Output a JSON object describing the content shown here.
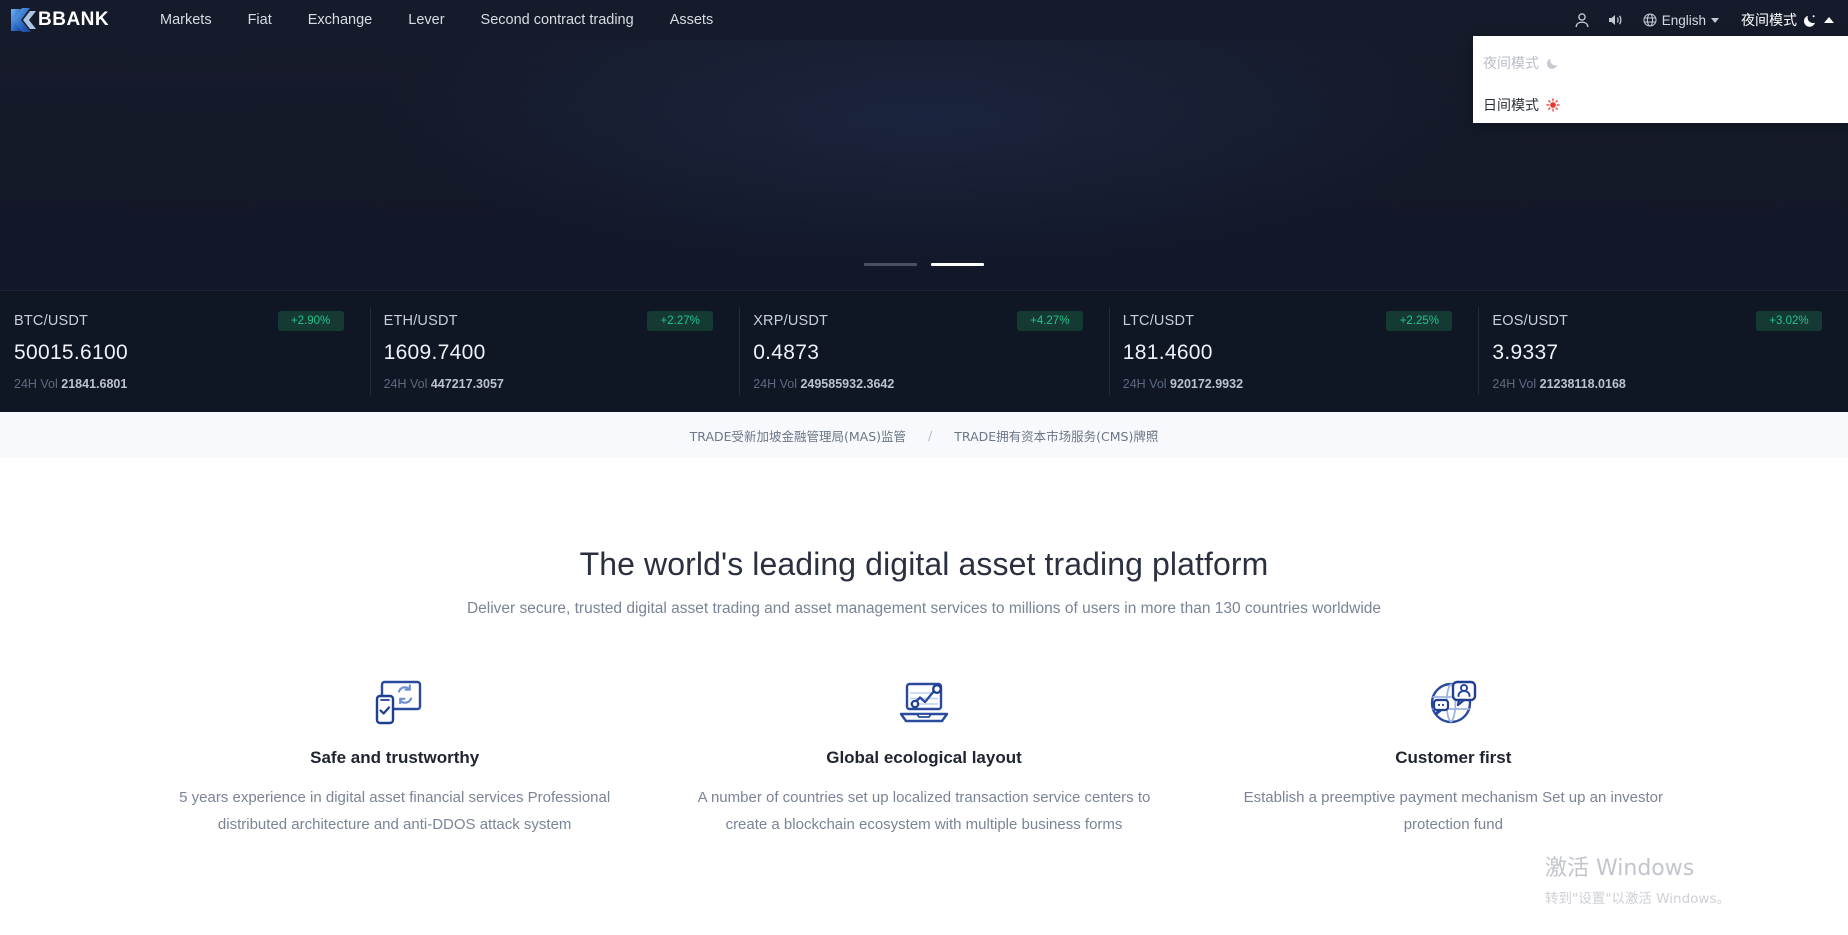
{
  "header": {
    "logo_text": "BBANK",
    "logo_icon": "k-logo-icon",
    "nav": [
      {
        "label": "Markets"
      },
      {
        "label": "Fiat"
      },
      {
        "label": "Exchange"
      },
      {
        "label": "Lever"
      },
      {
        "label": "Second contract trading"
      },
      {
        "label": "Assets"
      }
    ],
    "account_icon": "user-icon",
    "sound_icon": "speaker-icon",
    "globe_icon": "globe-icon",
    "language": "English",
    "theme_label": "夜间模式",
    "moon_icon": "moon-icon"
  },
  "theme_menu": {
    "items": [
      {
        "label": "夜间模式",
        "icon": "moon-icon"
      },
      {
        "label": "日间模式",
        "icon": "sun-icon"
      }
    ]
  },
  "hero": {
    "carousel": {
      "slides": 2,
      "active_index": 1
    }
  },
  "tickers": [
    {
      "pair": "BTC/USDT",
      "change": "+2.90%",
      "price": "50015.6100",
      "vol_label": "24H Vol",
      "vol": "21841.6801"
    },
    {
      "pair": "ETH/USDT",
      "change": "+2.27%",
      "price": "1609.7400",
      "vol_label": "24H Vol",
      "vol": "447217.3057"
    },
    {
      "pair": "XRP/USDT",
      "change": "+4.27%",
      "price": "0.4873",
      "vol_label": "24H Vol",
      "vol": "249585932.3642"
    },
    {
      "pair": "LTC/USDT",
      "change": "+2.25%",
      "price": "181.4600",
      "vol_label": "24H Vol",
      "vol": "920172.9932"
    },
    {
      "pair": "EOS/USDT",
      "change": "+3.02%",
      "price": "3.9337",
      "vol_label": "24H Vol",
      "vol": "21238118.0168"
    }
  ],
  "license_bar": {
    "left": "TRADE受新加坡金融管理局(MAS)监管",
    "separator": "/",
    "right": "TRADE拥有资本市场服务(CMS)牌照"
  },
  "main": {
    "title": "The world's leading digital asset trading platform",
    "subtitle": "Deliver secure, trusted digital asset trading and asset management services to millions of users in more than 130 countries worldwide",
    "features": [
      {
        "icon": "monitor-sync-icon",
        "title": "Safe and trustworthy",
        "desc": "5 years experience in digital asset financial services\nProfessional distributed architecture and anti-DDOS attack system"
      },
      {
        "icon": "laptop-chart-icon",
        "title": "Global ecological layout",
        "desc": "A number of countries set up localized transaction service centers\nto create a blockchain ecosystem with multiple business forms"
      },
      {
        "icon": "globe-support-icon",
        "title": "Customer first",
        "desc": "Establish a preemptive payment mechanism\nSet up an investor protection fund"
      }
    ]
  },
  "watermark": {
    "title": "激活 Windows",
    "subtitle": "转到\"设置\"以激活 Windows。"
  },
  "colors": {
    "header_bg": "#161b2b",
    "ticker_bg": "#0f1724",
    "accent_green": "#23c48a",
    "badge_bg": "#143a33",
    "license_bg": "#f7f9fc",
    "icon_blue": "#2b4a9e",
    "title_color": "#2b3040"
  }
}
